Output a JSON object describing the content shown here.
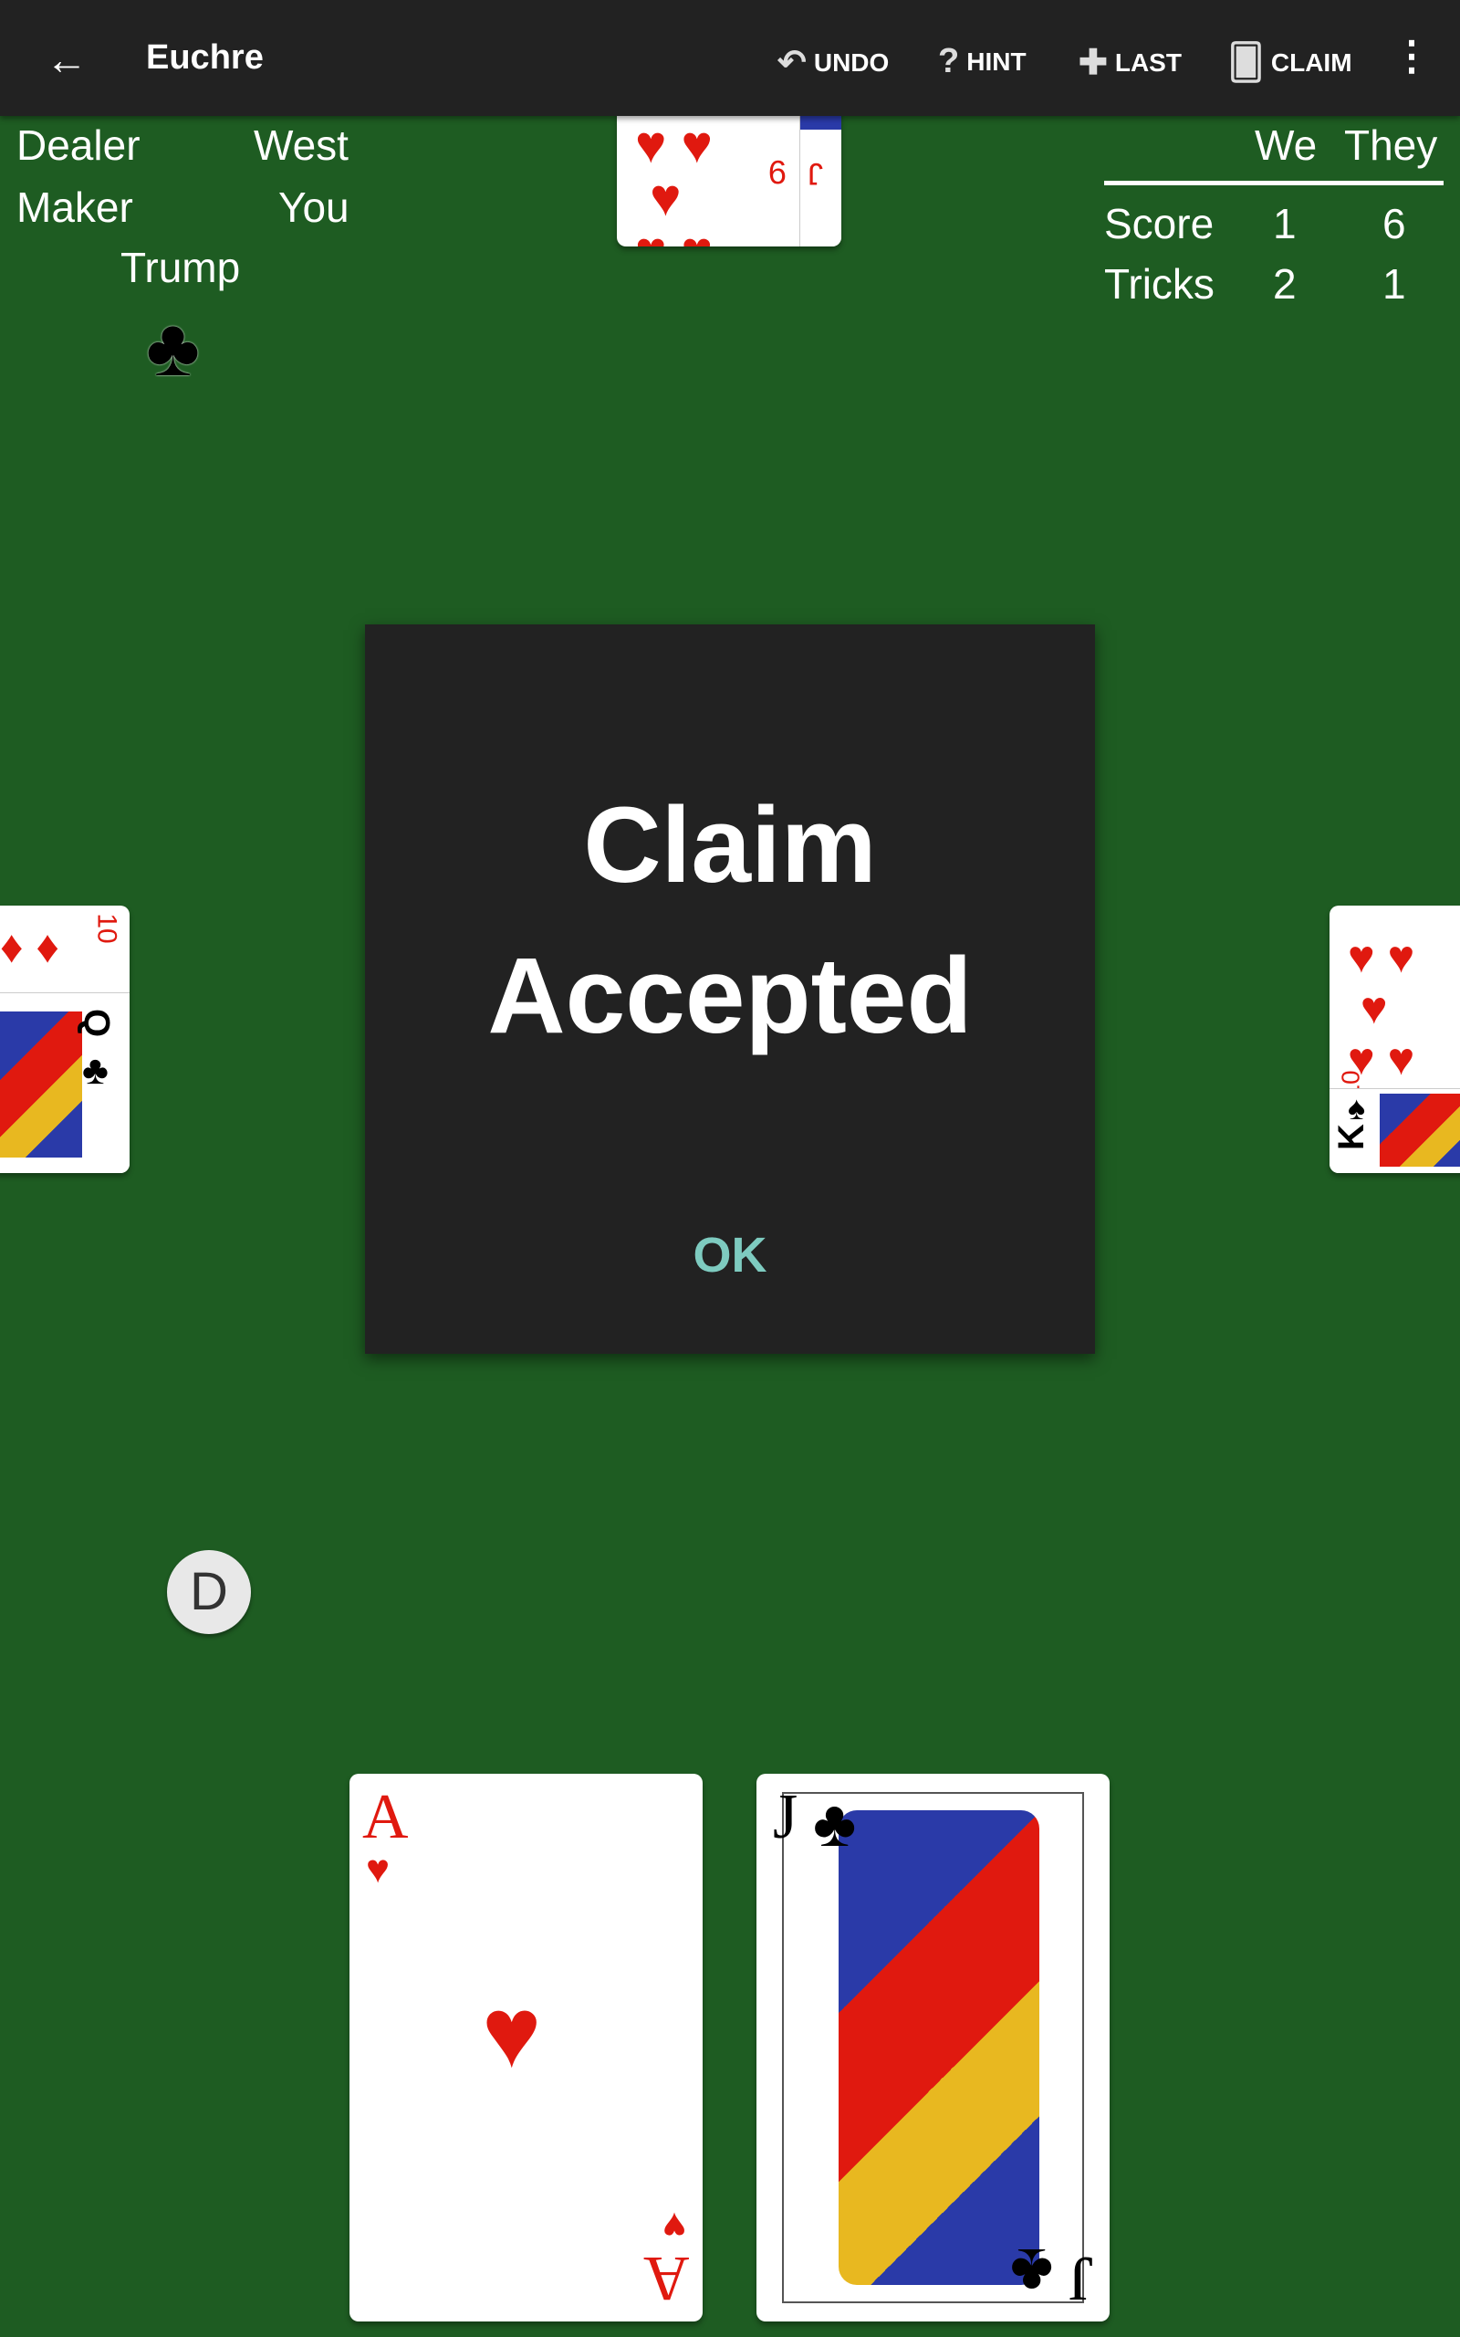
{
  "toolbar": {
    "title": "Euchre",
    "back_icon": "arrow-left-icon",
    "undo": "UNDO",
    "hint": "HINT",
    "last": "LAST",
    "claim": "CLAIM",
    "more_icon": "more-vert-icon"
  },
  "info": {
    "dealer_label": "Dealer",
    "dealer_value": "West",
    "maker_label": "Maker",
    "maker_value": "You",
    "trump_label": "Trump",
    "trump_suit": "♣"
  },
  "scoreboard": {
    "col_we": "We",
    "col_they": "They",
    "rows": [
      {
        "label": "Score",
        "we": "1",
        "they": "6"
      },
      {
        "label": "Tricks",
        "we": "2",
        "they": "1"
      }
    ]
  },
  "dialog": {
    "message": "Claim Accepted",
    "ok": "OK"
  },
  "dealer_chip": "D",
  "cards": {
    "north": [
      {
        "rank": "9",
        "suit": "♥"
      },
      {
        "rank": "J",
        "suit": "♦"
      }
    ],
    "west": [
      {
        "rank": "10",
        "suit": "♦"
      },
      {
        "rank": "Q",
        "suit": "♣"
      }
    ],
    "east": [
      {
        "rank": "10",
        "suit": "♥"
      },
      {
        "rank": "K",
        "suit": "♠"
      }
    ],
    "hand": [
      {
        "rank": "A",
        "suit": "♥"
      },
      {
        "rank": "J",
        "suit": "♣"
      }
    ]
  },
  "colors": {
    "table": "#1e5c22",
    "toolbar": "#222222",
    "ok": "#7ecbc0",
    "red_suit": "#e0190f"
  }
}
